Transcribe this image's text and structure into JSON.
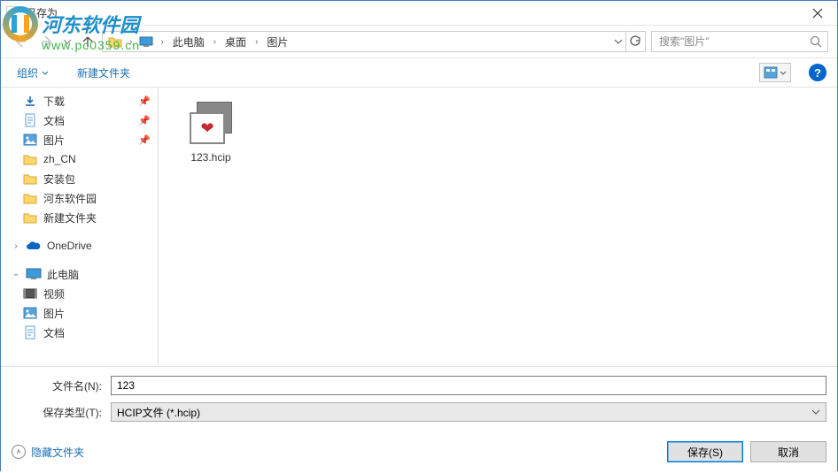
{
  "window": {
    "title": "另存为"
  },
  "watermark": {
    "text": "河东软件园",
    "url": "www.pc0359.cn"
  },
  "breadcrumb": {
    "segments": [
      "此电脑",
      "桌面",
      "图片"
    ]
  },
  "search": {
    "placeholder": "搜索\"图片\""
  },
  "toolbar": {
    "organize": "组织",
    "newfolder": "新建文件夹"
  },
  "sidebar": {
    "items": [
      {
        "label": "下载",
        "icon": "download",
        "pinned": true
      },
      {
        "label": "文档",
        "icon": "doc",
        "pinned": true
      },
      {
        "label": "图片",
        "icon": "picture",
        "pinned": true
      },
      {
        "label": "zh_CN",
        "icon": "folder",
        "pinned": false
      },
      {
        "label": "安装包",
        "icon": "folder",
        "pinned": false
      },
      {
        "label": "河东软件园",
        "icon": "folder",
        "pinned": false
      },
      {
        "label": "新建文件夹",
        "icon": "folder",
        "pinned": false
      }
    ],
    "onedrive": "OneDrive",
    "thispc": "此电脑",
    "thispc_children": [
      {
        "label": "视频",
        "icon": "video"
      },
      {
        "label": "图片",
        "icon": "picture"
      },
      {
        "label": "文档",
        "icon": "doc"
      }
    ]
  },
  "files": [
    {
      "name": "123.hcip"
    }
  ],
  "form": {
    "filename_label": "文件名(N):",
    "filename_value": "123",
    "filetype_label": "保存类型(T):",
    "filetype_value": "HCIP文件 (*.hcip)"
  },
  "footer": {
    "hide_folders": "隐藏文件夹",
    "save": "保存(S)",
    "cancel": "取消"
  }
}
